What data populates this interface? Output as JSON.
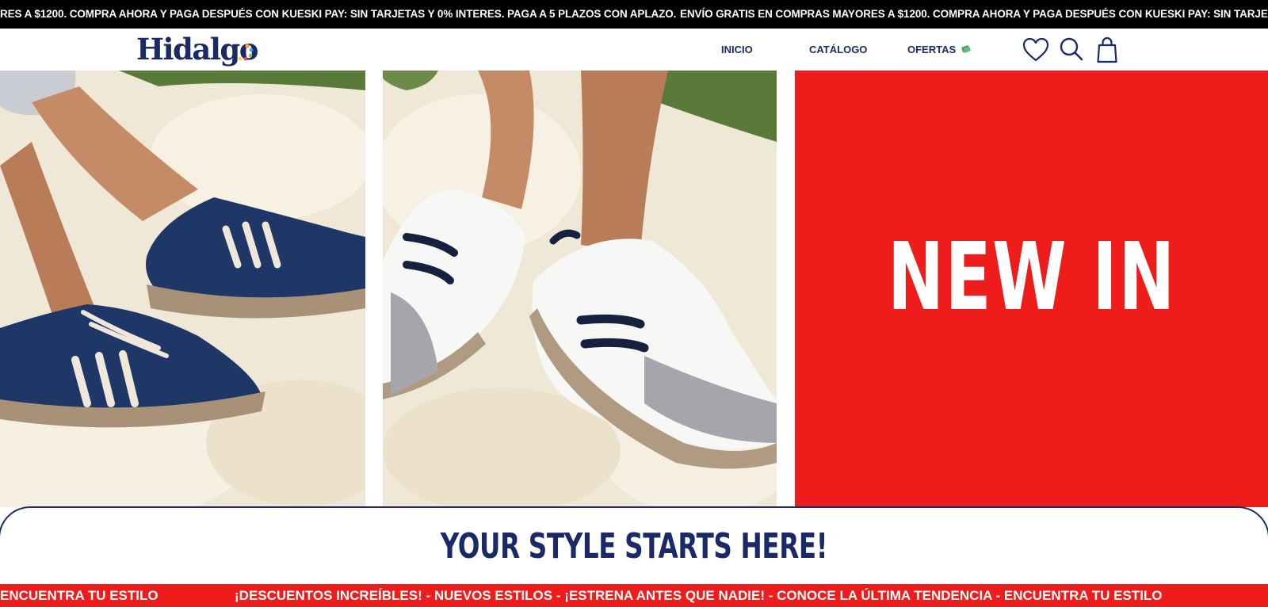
{
  "announcement": {
    "segment_1": "RES A $1200. COMPRA AHORA Y PAGA DESPUÉS CON KUESKI PAY: SIN TARJETAS Y 0% INTERES. PAGA A 5 PLAZOS CON APLAZO.",
    "segment_2": "ENVÍO GRATIS EN COMPRAS MAYORES A $1200. COMPRA AHORA Y PAGA DESPUÉS CON KUESKI PAY: SIN TARJETAS Y 0% INTER"
  },
  "header": {
    "logo_text": "Hidalgo",
    "nav": {
      "inicio": "INICIO",
      "catalogo": "CATÁLOGO",
      "ofertas": "OFERTAS"
    },
    "icons": [
      "heart-icon",
      "search-icon",
      "shopping-bag-icon",
      "money-icon"
    ]
  },
  "hero": {
    "new_in_label": "NEW IN"
  },
  "banner": {
    "headline": "YOUR STYLE STARTS HERE!"
  },
  "bottom_ticker": {
    "segment_1": "ENCUENTRA TU ESTILO",
    "segment_2": "¡DESCUENTOS INCREÍBLES! - NUEVOS ESTILOS - ¡ESTRENA ANTES QUE NADIE! - CONOCE LA ÚLTIMA TENDENCIA - ENCUENTRA TU ESTILO"
  },
  "colors": {
    "brand_navy": "#1b2a66",
    "accent_red": "#ef1c1c",
    "announcement_bg": "#000000"
  }
}
